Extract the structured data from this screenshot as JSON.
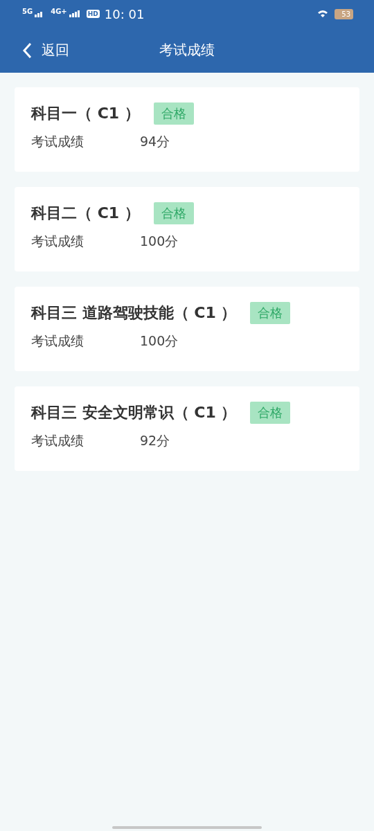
{
  "status_bar": {
    "network_1": "5G",
    "network_2": "4G+",
    "hd": "HD",
    "time": "10: 01",
    "battery": "53"
  },
  "nav": {
    "back": "返回",
    "title": "考试成绩"
  },
  "results": [
    {
      "subject": "科目一（ C1 ）",
      "status": "合格",
      "label": "考试成绩",
      "score": "94分"
    },
    {
      "subject": "科目二（ C1 ）",
      "status": "合格",
      "label": "考试成绩",
      "score": "100分"
    },
    {
      "subject": "科目三 道路驾驶技能（ C1 ）",
      "status": "合格",
      "label": "考试成绩",
      "score": "100分"
    },
    {
      "subject": "科目三 安全文明常识（ C1 ）",
      "status": "合格",
      "label": "考试成绩",
      "score": "92分"
    }
  ]
}
